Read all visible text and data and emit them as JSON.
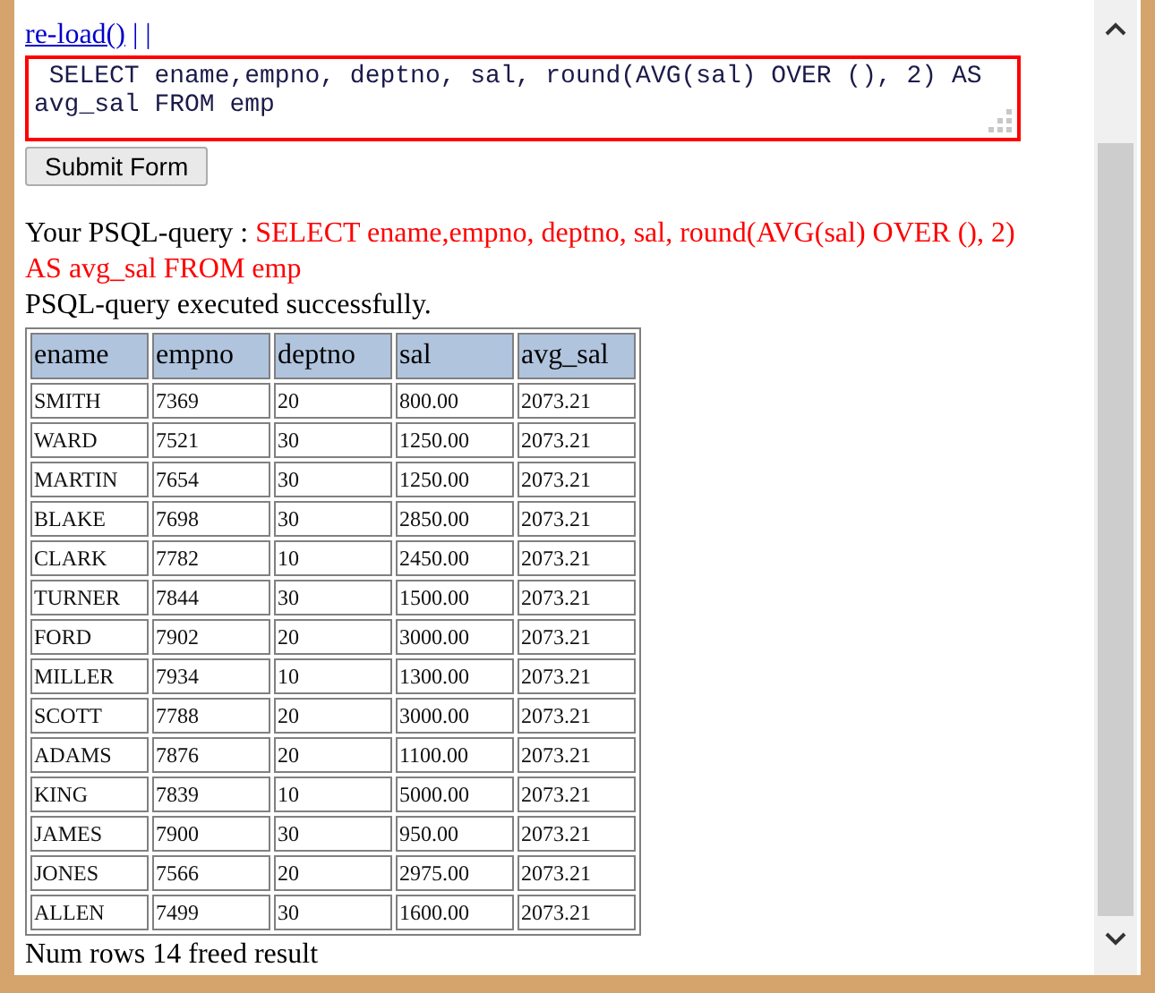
{
  "reload_link": "re-load()",
  "separator": "| |",
  "query_field": {
    "value": " SELECT ename,empno, deptno, sal, round(AVG(sal) OVER (), 2) AS avg_sal FROM emp "
  },
  "submit_button": "Submit Form",
  "result": {
    "label": "Your PSQL-query :",
    "query": " SELECT ename,empno, deptno, sal, round(AVG(sal) OVER (), 2) AS avg_sal FROM emp",
    "message": "PSQL-query executed successfully."
  },
  "table": {
    "columns": [
      "ename",
      "empno",
      "deptno",
      "sal",
      "avg_sal"
    ],
    "rows": [
      [
        "SMITH",
        "7369",
        "20",
        "800.00",
        "2073.21"
      ],
      [
        "WARD",
        "7521",
        "30",
        "1250.00",
        "2073.21"
      ],
      [
        "MARTIN",
        "7654",
        "30",
        "1250.00",
        "2073.21"
      ],
      [
        "BLAKE",
        "7698",
        "30",
        "2850.00",
        "2073.21"
      ],
      [
        "CLARK",
        "7782",
        "10",
        "2450.00",
        "2073.21"
      ],
      [
        "TURNER",
        "7844",
        "30",
        "1500.00",
        "2073.21"
      ],
      [
        "FORD",
        "7902",
        "20",
        "3000.00",
        "2073.21"
      ],
      [
        "MILLER",
        "7934",
        "10",
        "1300.00",
        "2073.21"
      ],
      [
        "SCOTT",
        "7788",
        "20",
        "3000.00",
        "2073.21"
      ],
      [
        "ADAMS",
        "7876",
        "20",
        "1100.00",
        "2073.21"
      ],
      [
        "KING",
        "7839",
        "10",
        "5000.00",
        "2073.21"
      ],
      [
        "JAMES",
        "7900",
        "30",
        "950.00",
        "2073.21"
      ],
      [
        "JONES",
        "7566",
        "20",
        "2975.00",
        "2073.21"
      ],
      [
        "ALLEN",
        "7499",
        "30",
        "1600.00",
        "2073.21"
      ]
    ]
  },
  "footer": "Num rows 14 freed result"
}
